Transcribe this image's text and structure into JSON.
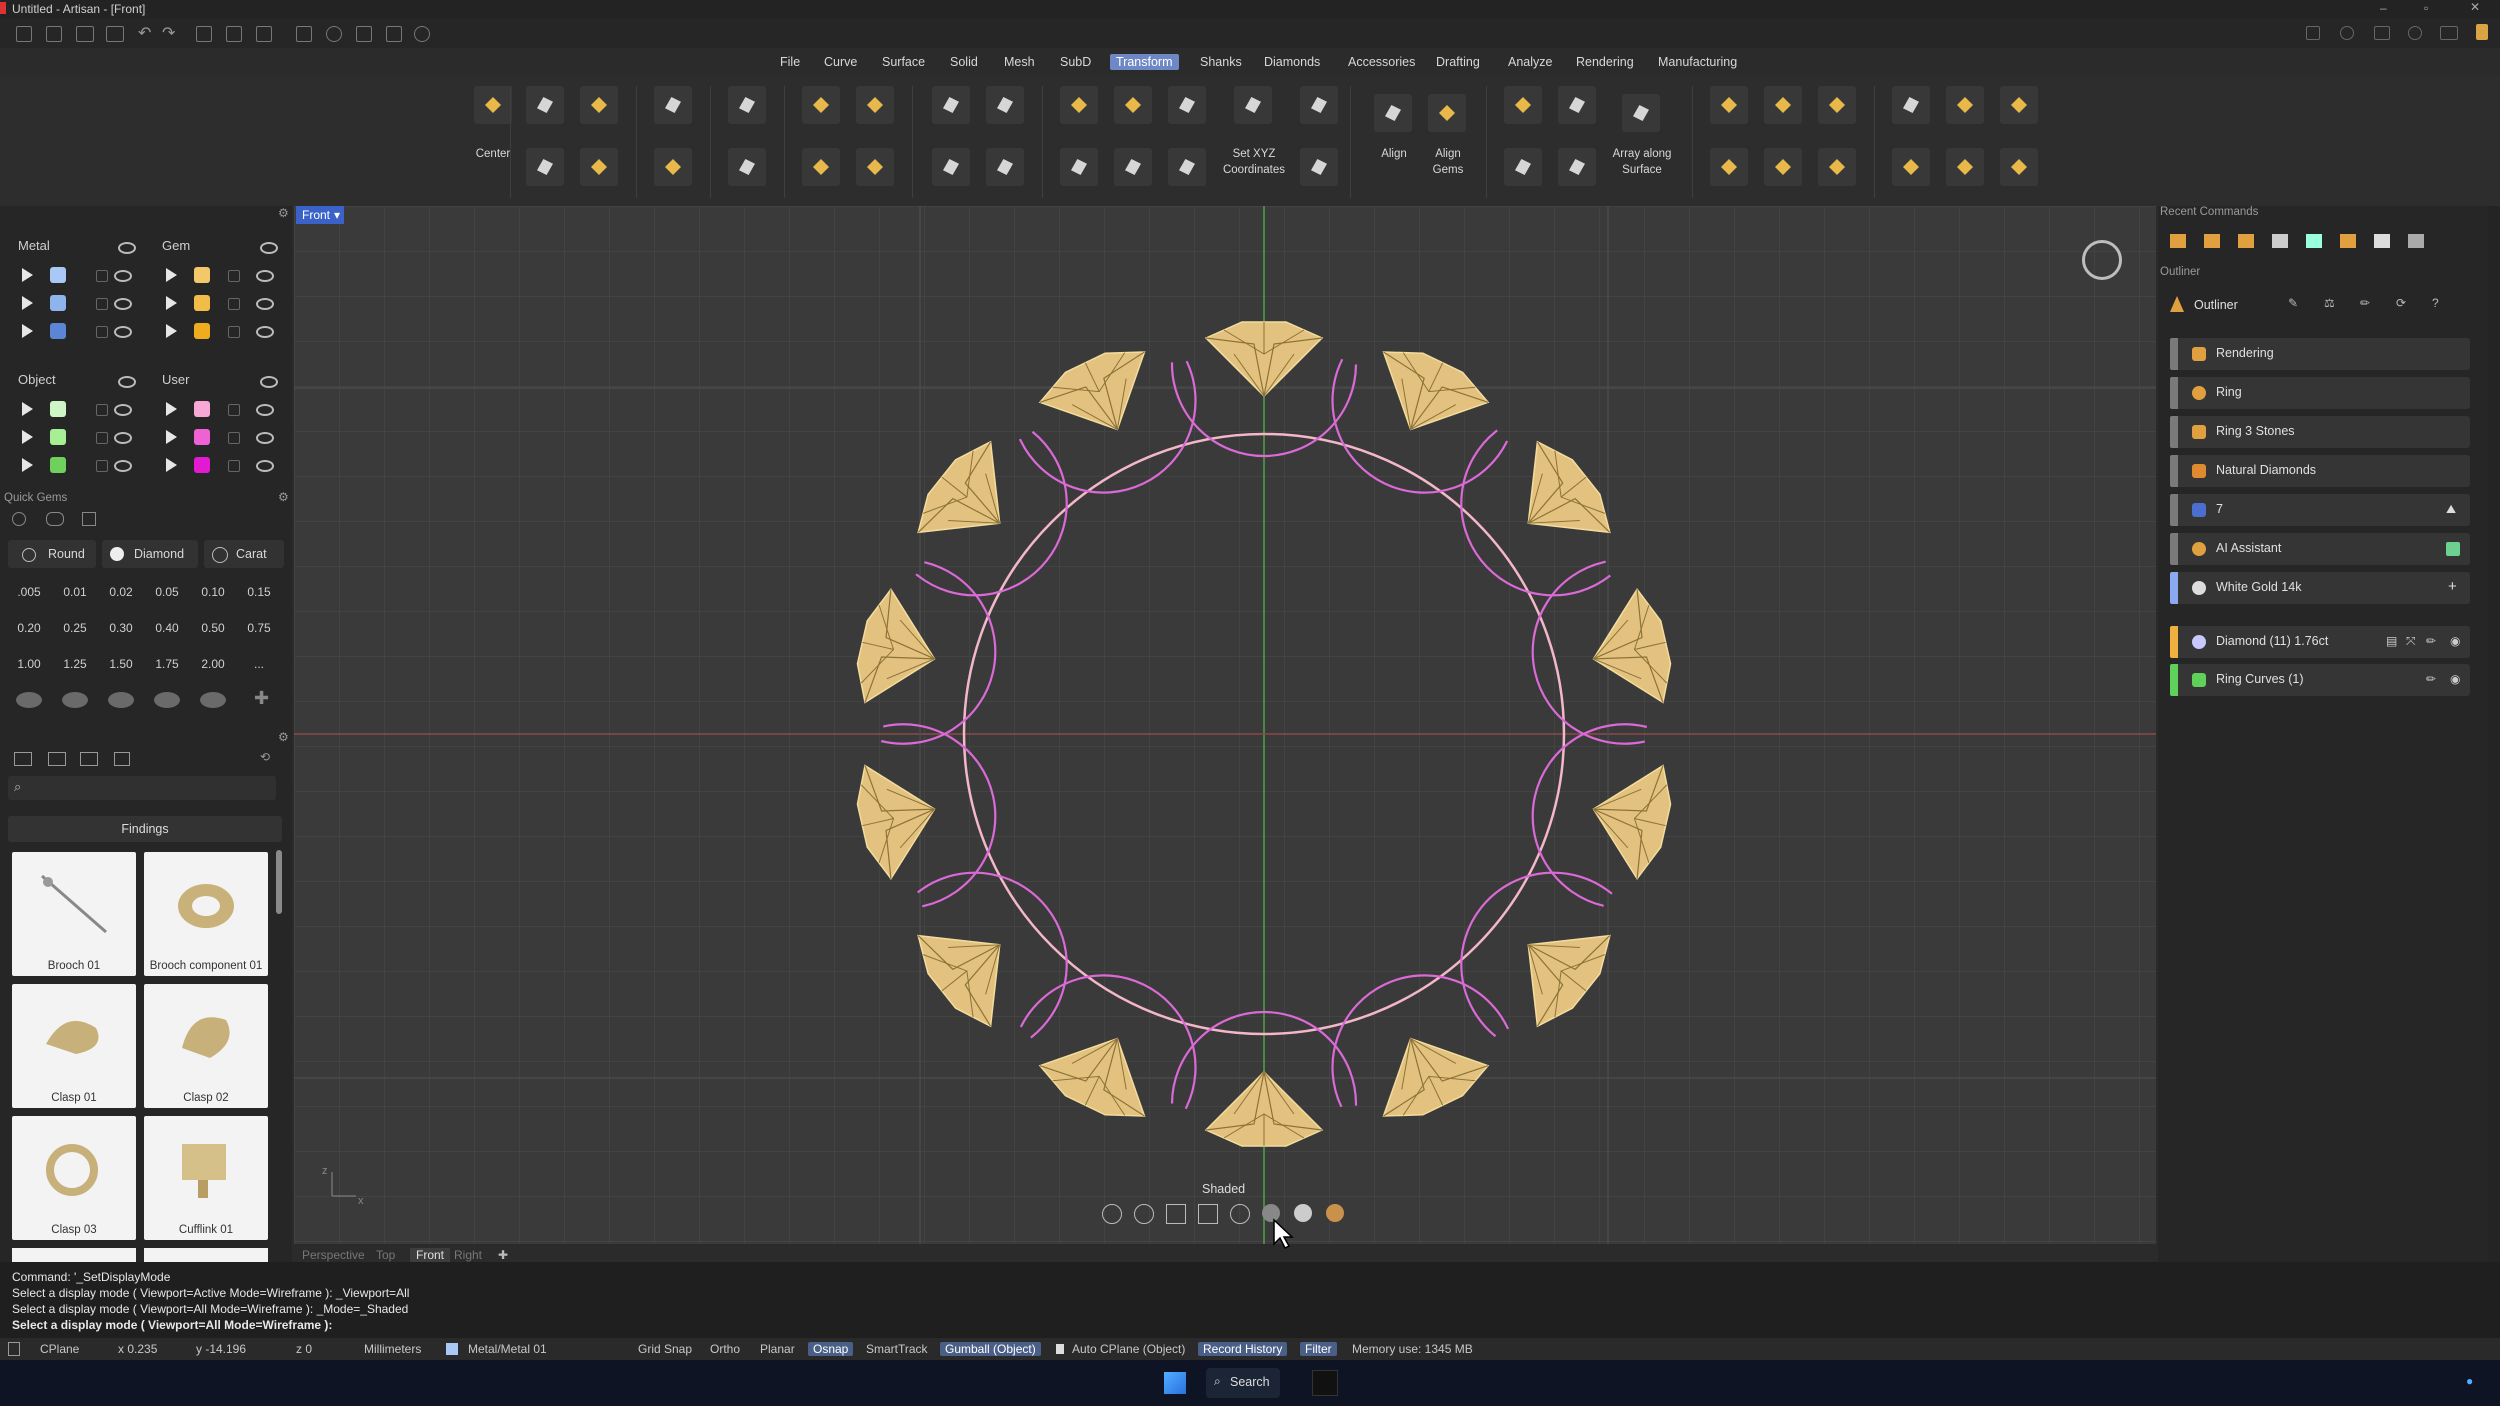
{
  "window": {
    "title": "Untitled - Artisan - [Front]"
  },
  "menu": [
    "File",
    "Curve",
    "Surface",
    "Solid",
    "Mesh",
    "SubD",
    "Transform",
    "Shanks",
    "Diamonds",
    "Accessories",
    "Drafting",
    "Analyze",
    "Rendering",
    "Manufacturing"
  ],
  "menu_active": "Transform",
  "ribbon": {
    "center": "Center",
    "set_xyz_1": "Set XYZ",
    "set_xyz_2": "Coordinates",
    "align": "Align",
    "align_gems_1": "Align",
    "align_gems_2": "Gems",
    "array_1": "Array along",
    "array_2": "Surface"
  },
  "layers": {
    "metal": "Metal",
    "gem": "Gem",
    "object": "Object",
    "user": "User",
    "metal_colors": [
      "#a9c8f5",
      "#8eb4ee",
      "#5b86d6"
    ],
    "gem_colors": [
      "#f4c86a",
      "#f1bd48",
      "#eeac1e"
    ],
    "object_colors": [
      "#cdf5c6",
      "#a6ef94",
      "#70d05c"
    ],
    "user_colors": [
      "#f7a8d6",
      "#ee62d4",
      "#e21ad2"
    ]
  },
  "quick_gems": {
    "title": "Quick Gems",
    "cut": "Round",
    "stone": "Diamond",
    "unit": "Carat",
    "sizes": [
      ".005",
      "0.01",
      "0.02",
      "0.05",
      "0.10",
      "0.15",
      "0.20",
      "0.25",
      "0.30",
      "0.40",
      "0.50",
      "0.75",
      "1.00",
      "1.25",
      "1.50",
      "1.75",
      "2.00",
      "..."
    ]
  },
  "library": {
    "category": "Findings",
    "items": [
      "Brooch 01",
      "Brooch component 01",
      "Clasp 01",
      "Clasp 02",
      "Clasp 03",
      "Cufflink 01"
    ]
  },
  "viewport": {
    "name": "Front",
    "display_mode_tooltip": "Shaded",
    "tabs": [
      "Perspective",
      "Top",
      "Front",
      "Right"
    ],
    "active_tab": "Front",
    "gem_count": 14
  },
  "right_panel": {
    "recent_commands": "Recent Commands",
    "outliner_header": "Outliner",
    "outliner_title": "Outliner",
    "items": [
      {
        "label": "Rendering",
        "bar": "#7a7a7a",
        "icon": "#e0a040"
      },
      {
        "label": "Ring",
        "bar": "#7a7a7a",
        "icon": "#e0a040"
      },
      {
        "label": "Ring 3 Stones",
        "bar": "#7a7a7a",
        "icon": "#e0a040"
      },
      {
        "label": "Natural Diamonds",
        "bar": "#7a7a7a",
        "icon": "#e08a30"
      },
      {
        "label": "7",
        "bar": "#7a7a7a",
        "icon": "#4b6fd0"
      },
      {
        "label": "AI Assistant",
        "bar": "#7a7a7a",
        "icon": "#e0a040"
      },
      {
        "label": "White Gold 14k",
        "bar": "#8aa9f0",
        "icon": "#dddddd"
      },
      {
        "label": "Diamond (11) 1.76ct",
        "bar": "#f0b040",
        "icon": "#c8c8ff"
      },
      {
        "label": "Ring Curves (1)",
        "bar": "#5fd05a",
        "icon": "#5fd05a"
      }
    ]
  },
  "command": {
    "lines": [
      "Command: '_SetDisplayMode",
      "Select a display mode ( Viewport=Active  Mode=Wireframe ): _Viewport=All",
      "Select a display mode ( Viewport=All  Mode=Wireframe ): _Mode=_Shaded"
    ],
    "prompt": "Select a display mode ( Viewport=All  Mode=Wireframe ):"
  },
  "status": {
    "cplane": "CPlane",
    "x": "x 0.235",
    "y": "y -14.196",
    "z": "z 0",
    "units": "Millimeters",
    "layer": "Metal/Metal 01",
    "grid_snap": "Grid Snap",
    "ortho": "Ortho",
    "planar": "Planar",
    "osnap": "Osnap",
    "smarttrack": "SmartTrack",
    "gumball": "Gumball (Object)",
    "auto_cplane": "Auto CPlane (Object)",
    "record_history": "Record History",
    "filter": "Filter",
    "memory": "Memory use: 1345 MB"
  },
  "taskbar": {
    "search": "Search"
  }
}
